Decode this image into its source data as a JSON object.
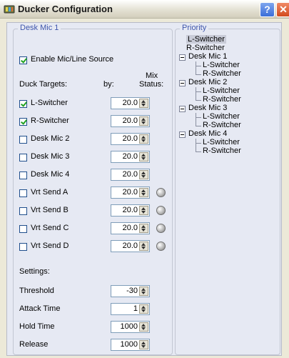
{
  "window": {
    "title": "Ducker Configuration",
    "help_label": "?",
    "close_label": "✕"
  },
  "desk": {
    "group_title": "Desk Mic 1",
    "enable_label": "Enable Mic/Line Source",
    "enable_checked": true,
    "hdr_targets": "Duck Targets:",
    "hdr_by": "by:",
    "hdr_mix_1": "Mix",
    "hdr_mix_2": "Status:",
    "targets": [
      {
        "label": "L-Switcher",
        "checked": true,
        "value": "20.0"
      },
      {
        "label": "R-Switcher",
        "checked": true,
        "value": "20.0"
      },
      {
        "label": "Desk Mic 2",
        "checked": false,
        "value": "20.0"
      },
      {
        "label": "Desk Mic 3",
        "checked": false,
        "value": "20.0"
      },
      {
        "label": "Desk Mic 4",
        "checked": false,
        "value": "20.0"
      },
      {
        "label": "Vrt Send A",
        "checked": false,
        "value": "20.0"
      },
      {
        "label": "Vrt Send B",
        "checked": false,
        "value": "20.0"
      },
      {
        "label": "Vrt Send C",
        "checked": false,
        "value": "20.0"
      },
      {
        "label": "Vrt Send D",
        "checked": false,
        "value": "20.0"
      }
    ],
    "settings_label": "Settings:",
    "settings": [
      {
        "label": "Threshold",
        "value": "-30"
      },
      {
        "label": "Attack Time",
        "value": "1"
      },
      {
        "label": "Hold Time",
        "value": "1000"
      },
      {
        "label": "Release",
        "value": "1000"
      }
    ]
  },
  "priority": {
    "group_title": "Priority",
    "items": [
      "L-Switcher",
      "R-Switcher"
    ],
    "groups": [
      {
        "label": "Desk Mic 1",
        "children": [
          "L-Switcher",
          "R-Switcher"
        ]
      },
      {
        "label": "Desk Mic 2",
        "children": [
          "L-Switcher",
          "R-Switcher"
        ]
      },
      {
        "label": "Desk Mic 3",
        "children": [
          "L-Switcher",
          "R-Switcher"
        ]
      },
      {
        "label": "Desk Mic 4",
        "children": [
          "L-Switcher",
          "R-Switcher"
        ]
      }
    ]
  }
}
